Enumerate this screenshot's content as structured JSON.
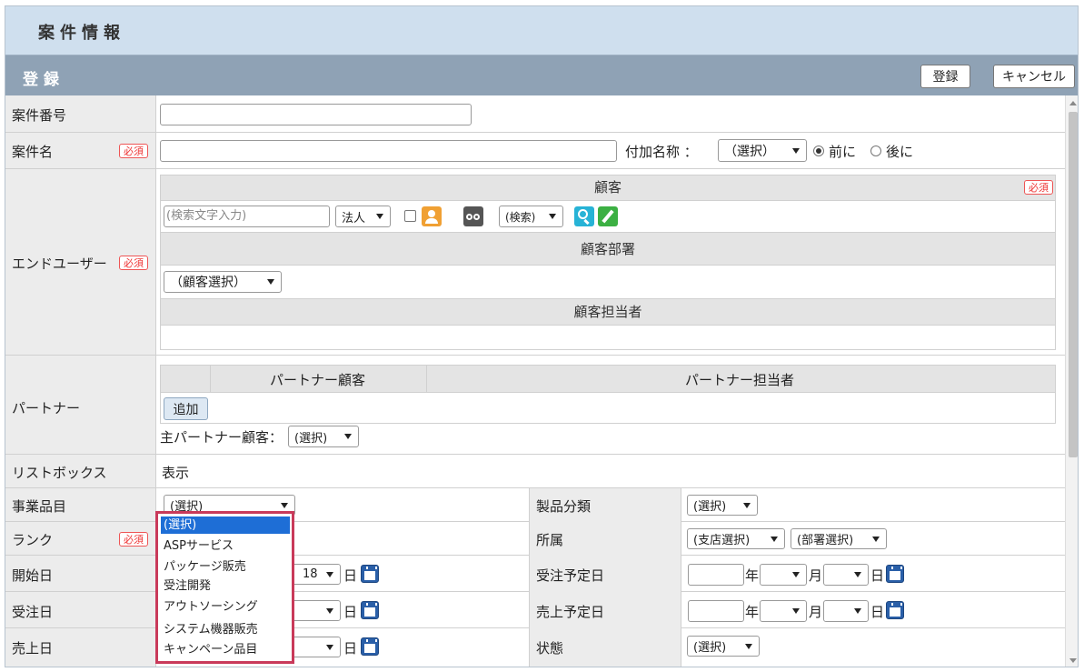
{
  "header": {
    "title": "案件情報"
  },
  "subheader": {
    "title": "登録",
    "register_button": "登録",
    "cancel_button": "キャンセル"
  },
  "form": {
    "case_number": {
      "label": "案件番号",
      "value": ""
    },
    "case_name": {
      "label": "案件名",
      "required": "必須",
      "value": "",
      "suffix_label": "付加名称 ：",
      "suffix_select": "（選択）",
      "radio_before": "前に",
      "radio_after": "後に"
    },
    "end_user": {
      "label": "エンドユーザー",
      "required": "必須",
      "customer_header": "顧客",
      "customer_required": "必須",
      "search_placeholder": "(検索文字入力)",
      "type_select": "法人",
      "search_select": "(検索)",
      "department_header": "顧客部署",
      "department_select": "（顧客選択）",
      "contact_header": "顧客担当者"
    },
    "partner": {
      "label": "パートナー",
      "col_customer": "パートナー顧客",
      "col_contact": "パートナー担当者",
      "add_button": "追加",
      "main_label": "主パートナー顧客：",
      "main_select": "(選択)"
    },
    "listbox": {
      "label": "リストボックス",
      "value": "表示"
    },
    "business_item": {
      "label": "事業品目",
      "select": "(選択)",
      "options": [
        "(選択)",
        "ASPサービス",
        "パッケージ販売",
        "受注開発",
        "アウトソーシング",
        "システム機器販売",
        "キャンペーン品目"
      ]
    },
    "product_category": {
      "label": "製品分類",
      "select": "(選択)"
    },
    "rank": {
      "label": "ランク",
      "required": "必須"
    },
    "affiliation": {
      "label": "所属",
      "branch_select": "(支店選択)",
      "dept_select": "(部署選択)"
    },
    "start_date": {
      "label": "開始日",
      "day_partial": "18",
      "day_unit": "日"
    },
    "order_planned": {
      "label": "受注予定日",
      "year_unit": "年",
      "month_unit": "月",
      "day_unit": "日"
    },
    "order_date": {
      "label": "受注日",
      "day_unit": "日"
    },
    "sales_planned": {
      "label": "売上予定日",
      "year_unit": "年",
      "month_unit": "月",
      "day_unit": "日"
    },
    "sales_date": {
      "label": "売上日",
      "day_unit": "日"
    },
    "status": {
      "label": "状態",
      "select": "(選択)"
    }
  },
  "colors": {
    "title_bg": "#cfdfee",
    "subbar_bg": "#8fa2b5",
    "label_bg": "#ececec",
    "highlight": "#c93a5a",
    "selected": "#1e6ed6"
  }
}
